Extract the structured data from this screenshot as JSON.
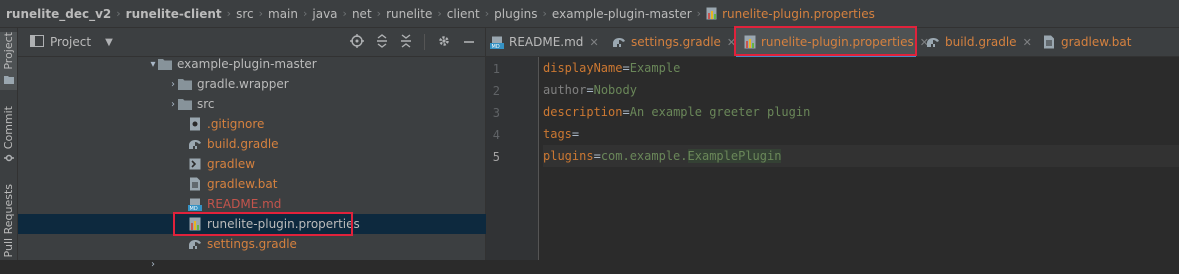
{
  "breadcrumbs": [
    "runelite_dec_v2",
    "runelite-client",
    "src",
    "main",
    "java",
    "net",
    "runelite",
    "client",
    "plugins",
    "example-plugin-master",
    "runelite-plugin.properties"
  ],
  "left_stripe": {
    "project": "Project",
    "commit": "Commit",
    "pull_requests": "Pull Requests"
  },
  "project_panel": {
    "title": "Project",
    "tree": [
      {
        "label": "example-plugin-master",
        "icon": "folder-icon",
        "arrow": "▾",
        "color": "normal"
      },
      {
        "label": "gradle.wrapper",
        "icon": "folder-icon",
        "arrow": "›",
        "color": "normal"
      },
      {
        "label": "src",
        "icon": "folder-icon",
        "arrow": "›",
        "color": "normal"
      },
      {
        "label": ".gitignore",
        "icon": "gitignore-file-icon",
        "arrow": "",
        "color": "orange"
      },
      {
        "label": "build.gradle",
        "icon": "gradle-file-icon",
        "arrow": "",
        "color": "orange"
      },
      {
        "label": "gradlew",
        "icon": "script-file-icon",
        "arrow": "",
        "color": "orange"
      },
      {
        "label": "gradlew.bat",
        "icon": "bat-file-icon",
        "arrow": "",
        "color": "orange"
      },
      {
        "label": "README.md",
        "icon": "markdown-file-icon",
        "arrow": "",
        "color": "red"
      },
      {
        "label": "runelite-plugin.properties",
        "icon": "properties-file-icon",
        "arrow": "",
        "color": "normal"
      },
      {
        "label": "settings.gradle",
        "icon": "gradle-file-icon",
        "arrow": "",
        "color": "orange"
      }
    ]
  },
  "editor_tabs": [
    {
      "label": "README.md",
      "icon": "markdown-file-icon",
      "color": "normal",
      "closable": true
    },
    {
      "label": "settings.gradle",
      "icon": "gradle-file-icon",
      "color": "orange",
      "closable": true
    },
    {
      "label": "runelite-plugin.properties",
      "icon": "properties-file-icon",
      "color": "orange",
      "closable": true
    },
    {
      "label": "build.gradle",
      "icon": "gradle-file-icon",
      "color": "orange",
      "closable": true
    },
    {
      "label": "gradlew.bat",
      "icon": "bat-file-icon",
      "color": "orange",
      "closable": false
    }
  ],
  "editor_lines": [
    {
      "num": "1",
      "key": "displayName",
      "value": "Example"
    },
    {
      "num": "2",
      "key": "author",
      "value": "Nobody"
    },
    {
      "num": "3",
      "key": "description",
      "value": "An example greeter plugin"
    },
    {
      "num": "4",
      "key": "tags",
      "value": ""
    },
    {
      "num": "5",
      "key": "plugins",
      "value": "com.example.",
      "value_class": "ExamplePlugin"
    }
  ],
  "colors": {
    "highlight_box": "#e0223b",
    "accent": "#4a88c7",
    "selected_row": "#0d293e"
  }
}
